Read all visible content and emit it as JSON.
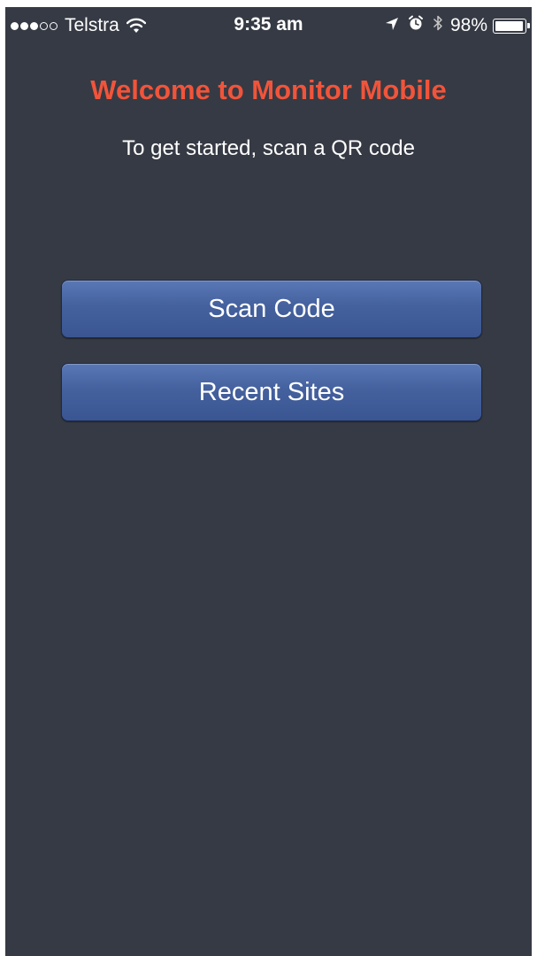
{
  "status_bar": {
    "signal_strength": "3 of 5",
    "carrier": "Telstra",
    "wifi_icon": "wifi-icon",
    "time": "9:35 am",
    "location_icon": "location-arrow-icon",
    "alarm_icon": "alarm-clock-icon",
    "bluetooth_icon": "bluetooth-icon",
    "battery_percent": "98%",
    "battery_level": 0.98
  },
  "main": {
    "title": "Welcome to Monitor Mobile",
    "subtitle": "To get started, scan a QR code",
    "scan_button_label": "Scan Code",
    "recent_button_label": "Recent Sites"
  },
  "colors": {
    "background": "#363a44",
    "title": "#f1543a",
    "button": "#44619e",
    "text": "#ffffff"
  }
}
